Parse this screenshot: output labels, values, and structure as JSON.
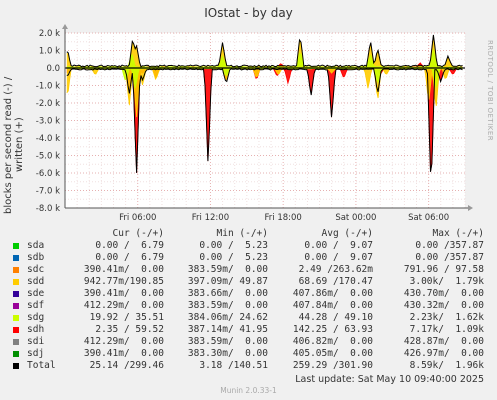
{
  "title": "IOstat - by day",
  "side_text": "RRDTOOL / TOBI OETIKER",
  "ylabel": "blocks per second read (-) / written (+)",
  "legend_header": {
    "cur": "Cur (-/+)",
    "min": "Min (-/+)",
    "avg": "Avg (-/+)",
    "max": "Max (-/+)"
  },
  "legend": [
    {
      "name": "sda",
      "color": "#00cc00",
      "cur": "0.00 /  6.79",
      "min": "0.00 /  5.23",
      "avg": "0.00 /  9.07",
      "max": "0.00 /357.87"
    },
    {
      "name": "sdb",
      "color": "#0066b3",
      "cur": "0.00 /  6.79",
      "min": "0.00 /  5.23",
      "avg": "0.00 /  9.07",
      "max": "0.00 /357.87"
    },
    {
      "name": "sdc",
      "color": "#ff8000",
      "cur": "390.41m/  0.00",
      "min": "383.59m/  0.00",
      "avg": "2.49 /263.62m",
      "max": "791.96 / 97.58"
    },
    {
      "name": "sdd",
      "color": "#ffcc00",
      "cur": "942.77m/190.85",
      "min": "397.09m/ 49.87",
      "avg": "68.69 /170.47",
      "max": "3.00k/  1.79k"
    },
    {
      "name": "sde",
      "color": "#330099",
      "cur": "390.41m/  0.00",
      "min": "383.66m/  0.00",
      "avg": "407.86m/  0.00",
      "max": "430.70m/  0.00"
    },
    {
      "name": "sdf",
      "color": "#990099",
      "cur": "412.29m/  0.00",
      "min": "383.59m/  0.00",
      "avg": "407.84m/  0.00",
      "max": "430.32m/  0.00"
    },
    {
      "name": "sdg",
      "color": "#ccff00",
      "cur": "19.92 / 35.51",
      "min": "384.06m/ 24.62",
      "avg": "44.28 / 49.10",
      "max": "2.23k/  1.62k"
    },
    {
      "name": "sdh",
      "color": "#ff0000",
      "cur": "2.35 / 59.52",
      "min": "387.14m/ 41.95",
      "avg": "142.25 / 63.93",
      "max": "7.17k/  1.09k"
    },
    {
      "name": "sdi",
      "color": "#808080",
      "cur": "412.29m/  0.00",
      "min": "383.59m/  0.00",
      "avg": "406.82m/  0.00",
      "max": "428.87m/  0.00"
    },
    {
      "name": "sdj",
      "color": "#008f00",
      "cur": "390.41m/  0.00",
      "min": "383.30m/  0.00",
      "avg": "405.05m/  0.00",
      "max": "426.97m/  0.00"
    },
    {
      "name": "Total",
      "color": "#000000",
      "cur": "25.14 /299.46",
      "min": "3.18 /140.51",
      "avg": "259.29 /301.90",
      "max": "8.59k/  1.96k"
    }
  ],
  "footer": "Last update:  Sat May 10 09:40:00 2025",
  "munin": "Munin 2.0.33-1",
  "chart_data": {
    "type": "area",
    "ylim": [
      -8000,
      2000
    ],
    "yticks": [
      {
        "v": 2000,
        "label": "2.0 k"
      },
      {
        "v": 1000,
        "label": "1.0 k"
      },
      {
        "v": 0,
        "label": "0.0"
      },
      {
        "v": -1000,
        "label": "-1.0 k"
      },
      {
        "v": -2000,
        "label": "-2.0 k"
      },
      {
        "v": -3000,
        "label": "-3.0 k"
      },
      {
        "v": -4000,
        "label": "-4.0 k"
      },
      {
        "v": -5000,
        "label": "-5.0 k"
      },
      {
        "v": -6000,
        "label": "-6.0 k"
      },
      {
        "v": -7000,
        "label": "-7.0 k"
      },
      {
        "v": -8000,
        "label": "-8.0 k"
      }
    ],
    "xlim": [
      0,
      33
    ],
    "xticks": [
      {
        "v": 6,
        "label": "Fri 06:00"
      },
      {
        "v": 12,
        "label": "Fri 12:00"
      },
      {
        "v": 18,
        "label": "Fri 18:00"
      },
      {
        "v": 24,
        "label": "Sat 00:00"
      },
      {
        "v": 30,
        "label": "Sat 06:00"
      }
    ],
    "grid": true,
    "series": [
      {
        "name": "sdh",
        "color": "#ff0000",
        "read": [
          [
            0.2,
            -300
          ],
          [
            5.3,
            -1300
          ],
          [
            5.9,
            -6200
          ],
          [
            6.4,
            -300
          ],
          [
            7.5,
            -600
          ],
          [
            11.8,
            -5500
          ],
          [
            13.3,
            -800
          ],
          [
            15.8,
            -700
          ],
          [
            17.5,
            -500
          ],
          [
            18.4,
            -900
          ],
          [
            20.3,
            -1500
          ],
          [
            22.0,
            -2900
          ],
          [
            23.0,
            -600
          ],
          [
            26.0,
            -400
          ],
          [
            30.2,
            -7100
          ],
          [
            31.0,
            -700
          ],
          [
            32.0,
            -400
          ]
        ],
        "write": [
          [
            5.6,
            300
          ],
          [
            17.8,
            250
          ],
          [
            29.3,
            300
          ]
        ]
      },
      {
        "name": "sdd",
        "color": "#ffcc00",
        "read": [
          [
            0.2,
            -1700
          ],
          [
            2.5,
            -400
          ],
          [
            5.3,
            -2200
          ],
          [
            5.9,
            -2900
          ],
          [
            6.4,
            -1000
          ],
          [
            7.5,
            -700
          ],
          [
            13.3,
            -800
          ],
          [
            15.8,
            -600
          ],
          [
            17.6,
            -400
          ],
          [
            22.0,
            -300
          ],
          [
            25.0,
            -1200
          ],
          [
            25.8,
            -1900
          ],
          [
            26.5,
            -400
          ],
          [
            30.0,
            -2000
          ],
          [
            30.6,
            -2400
          ],
          [
            31.4,
            -700
          ]
        ],
        "write": [
          [
            0.2,
            1000
          ],
          [
            5.6,
            1700
          ],
          [
            5.9,
            1300
          ],
          [
            13.0,
            1450
          ],
          [
            19.4,
            1800
          ],
          [
            25.2,
            1500
          ],
          [
            25.8,
            1100
          ],
          [
            30.4,
            1900
          ],
          [
            31.6,
            600
          ]
        ]
      },
      {
        "name": "sdg",
        "color": "#ccff00",
        "read": [
          [
            5.0,
            -800
          ],
          [
            5.8,
            -1200
          ],
          [
            13.3,
            -500
          ],
          [
            25.8,
            -900
          ],
          [
            30.6,
            -1200
          ]
        ],
        "write": [
          [
            5.5,
            900
          ],
          [
            13.0,
            700
          ],
          [
            19.4,
            1000
          ],
          [
            25.2,
            800
          ],
          [
            30.4,
            1100
          ]
        ]
      },
      {
        "name": "Total",
        "color": "#000000",
        "read": [
          [
            0.2,
            -500
          ],
          [
            5.3,
            -1500
          ],
          [
            5.9,
            -6200
          ],
          [
            6.4,
            -700
          ],
          [
            11.8,
            -5500
          ],
          [
            13.3,
            -900
          ],
          [
            20.3,
            -1600
          ],
          [
            22.0,
            -2900
          ],
          [
            25.8,
            -1500
          ],
          [
            30.2,
            -7100
          ],
          [
            31.0,
            -800
          ]
        ],
        "write": [
          [
            0.2,
            1100
          ],
          [
            5.6,
            1800
          ],
          [
            5.9,
            1300
          ],
          [
            13.0,
            1500
          ],
          [
            19.4,
            1900
          ],
          [
            25.2,
            1600
          ],
          [
            25.8,
            1100
          ],
          [
            30.4,
            1950
          ],
          [
            31.6,
            700
          ]
        ]
      }
    ]
  }
}
